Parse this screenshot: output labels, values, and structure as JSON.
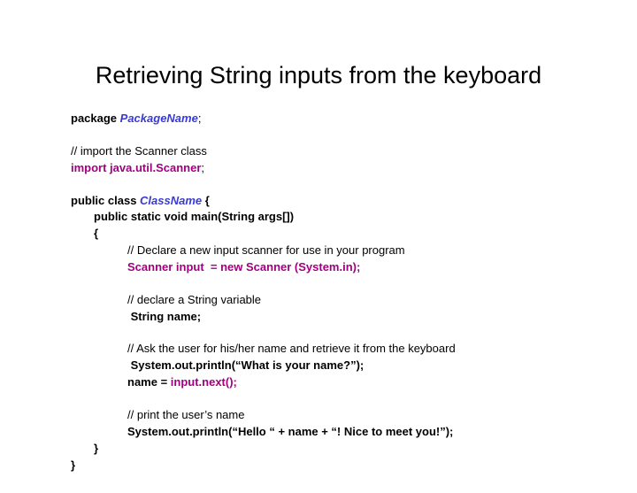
{
  "title": "Retrieving String inputs from the keyboard",
  "code": {
    "pkg_kw": "package ",
    "pkg_name": "PackageName",
    "semi": ";",
    "comment_import": "// import the Scanner class",
    "import_stmt": "import java.util.Scanner",
    "class_kw1": "public class ",
    "class_name": "ClassName",
    "class_kw2": " {",
    "main_sig": "public static void main(String args[])",
    "brace_open": "{",
    "c_scanner": "// Declare a new input scanner for use in your program",
    "scanner_line": "Scanner input  = new Scanner (System.in);",
    "c_stringvar": "// declare a String variable",
    "string_decl": " String name;",
    "c_ask": "// Ask the user for his/her name and retrieve it from the keyboard",
    "ask_line": " System.out.println(“What is your name?”);",
    "name_eq": "name = ",
    "input_next": "input.next();",
    "c_print": "// print the user’s name",
    "print_line": "System.out.println(“Hello “ + name + “! Nice to meet you!”);",
    "brace_close_i": "}",
    "brace_close": "}"
  }
}
